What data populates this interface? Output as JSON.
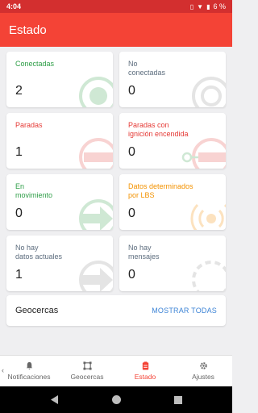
{
  "status_bar": {
    "time": "4:04",
    "battery": "6 %"
  },
  "app_bar": {
    "title": "Estado"
  },
  "cards": [
    {
      "label": "Conectadas",
      "count": "2",
      "color": "green",
      "icon": "connected-circle-icon"
    },
    {
      "label": "No\nconectadas",
      "count": "0",
      "color": "gray",
      "icon": "disconnected-circle-icon"
    },
    {
      "label": "Paradas",
      "count": "1",
      "color": "red",
      "icon": "stop-icon"
    },
    {
      "label": "Paradas con\nignición encendida",
      "count": "0",
      "color": "red",
      "icon": "key-stop-icon"
    },
    {
      "label": "En\nmovimiento",
      "count": "0",
      "color": "green",
      "icon": "moving-arrow-icon"
    },
    {
      "label": "Datos determinados\npor LBS",
      "count": "0",
      "color": "orange",
      "icon": "lbs-signal-icon"
    },
    {
      "label": "No hay\ndatos actuales",
      "count": "1",
      "color": "gray",
      "icon": "no-data-arrow-icon"
    },
    {
      "label": "No hay\nmensajes",
      "count": "0",
      "color": "gray",
      "icon": "no-messages-dashed-icon"
    }
  ],
  "geofences": {
    "title": "Geocercas",
    "action": "MOSTRAR TODAS"
  },
  "bottom_nav": [
    {
      "label": "Notificaciones",
      "icon": "bell-icon",
      "active": false
    },
    {
      "label": "Geocercas",
      "icon": "geofence-icon",
      "active": false
    },
    {
      "label": "Estado",
      "icon": "clipboard-icon",
      "active": true
    },
    {
      "label": "Ajustes",
      "icon": "gear-icon",
      "active": false
    }
  ],
  "colors": {
    "app_bar": "#f44336",
    "status_bar": "#d32f2f",
    "green": "#2e9e47",
    "red": "#e53935",
    "orange": "#f39200",
    "gray": "#5d6d7e",
    "link": "#3d84d6"
  }
}
